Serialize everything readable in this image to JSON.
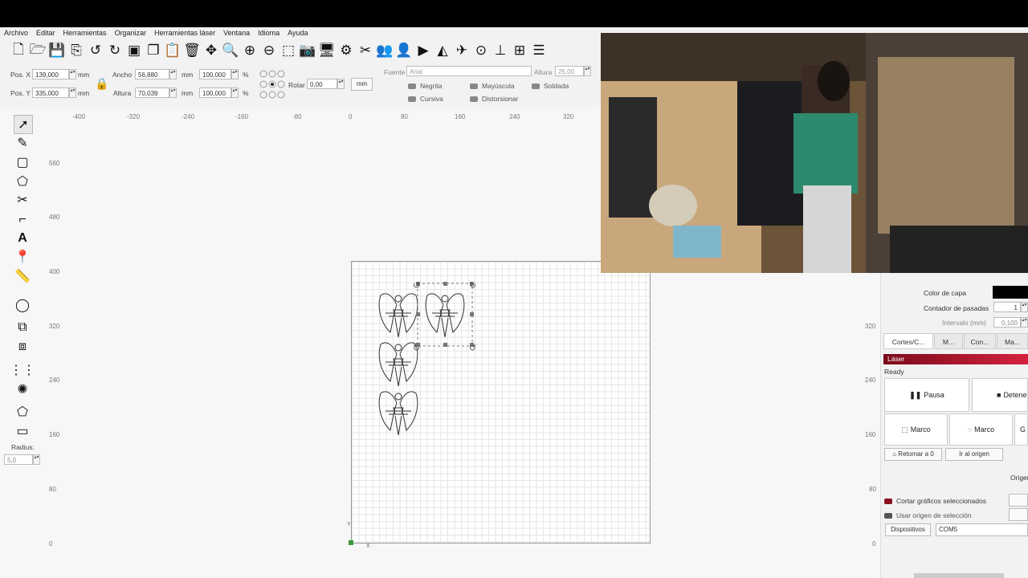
{
  "menu": [
    "Archivo",
    "Editar",
    "Herramientas",
    "Organizar",
    "Herramientas láser",
    "Ventana",
    "Idioma",
    "Ayuda"
  ],
  "toolbar_icons": [
    "new-file-icon",
    "open-folder-icon",
    "save-icon",
    "save-as-icon",
    "undo-icon",
    "redo-icon",
    "trace-image-icon",
    "copy-icon",
    "paste-icon",
    "delete-icon",
    "move-icon",
    "zoom-in-icon",
    "zoom-in-plus-icon",
    "zoom-out-icon",
    "zoom-to-frame-icon",
    "camera-icon",
    "monitor-icon",
    "settings-icon",
    "tools-icon",
    "users-icon",
    "user-icon",
    "send-icon",
    "mirror-icon",
    "plane-icon",
    "target-icon",
    "align-icon",
    "distribute-icon",
    "align-center-icon"
  ],
  "props": {
    "posx_label": "Pos. X",
    "posx_value": "139,000",
    "posx_unit": "mm",
    "posy_label": "Pos. Y",
    "posy_value": "335,000",
    "posy_unit": "mm",
    "width_label": "Ancho",
    "width_value": "56,880",
    "width_unit": "mm",
    "width_pct": "100,000",
    "pct_sign": "%",
    "height_label": "Altura",
    "height_value": "70,039",
    "height_unit": "mm",
    "height_pct": "100,000",
    "rotate_label": "Rotar",
    "rotate_value": "0,00",
    "unit_button": "mm",
    "font_label": "Fuente",
    "font_value": "Arial",
    "font_height_label": "Altura",
    "font_height_value": "25,00",
    "bold": "Negrita",
    "italic": "Cursiva",
    "uppercase": "Mayúscula",
    "distort": "Distorsionar",
    "weld": "Soldada"
  },
  "ruler_x": [
    "-400",
    "-320",
    "-240",
    "-160",
    "-80",
    "0",
    "80",
    "160",
    "240",
    "320"
  ],
  "ruler_y": [
    "560",
    "480",
    "400",
    "320",
    "240",
    "160",
    "80",
    "0"
  ],
  "ruler_y_right": [
    "320",
    "240",
    "160",
    "80",
    "0"
  ],
  "left_tools": {
    "radius_label": "Radius:",
    "radius_value": "5,0"
  },
  "canvas": {
    "axis_y": "Y",
    "axis_x": "X"
  },
  "right_panel": {
    "layer_color_label": "Color de capa",
    "pass_count_label": "Contador de pasadas",
    "pass_count_value": "1",
    "interval_label": "Intervalo (mm)",
    "interval_value": "0,100",
    "tabs": [
      "Cortes/C...",
      "M...",
      "Con...",
      "Ma..."
    ],
    "laser_header": "Láser",
    "status": "Ready",
    "pause": "Pausa",
    "stop": "Detene",
    "frame1": "Marco",
    "frame2": "Marco",
    "frame3": "G",
    "return_zero": "Retornar a 0",
    "go_origin": "Ir al origen",
    "origin": "Origen",
    "cut_selected": "Cortar gráficos seleccionados",
    "use_selection_origin": "Usar origen de selección",
    "devices": "Dispositivos",
    "port": "COM5"
  },
  "colors": {
    "layer_color": "#000000",
    "laser_header": "#8b0e1e",
    "accent_green": "#3a9a3a"
  }
}
